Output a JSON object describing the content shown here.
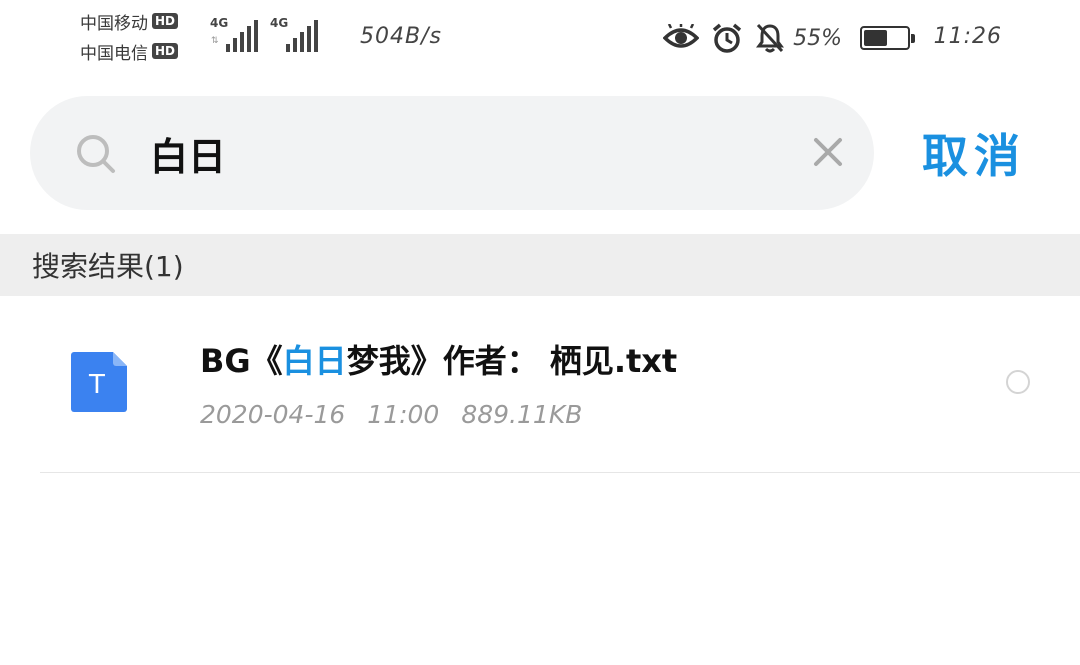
{
  "status_bar": {
    "carriers": [
      {
        "name": "中国移动",
        "badge": "HD",
        "network": "4G"
      },
      {
        "name": "中国电信",
        "badge": "HD",
        "network": "4G"
      }
    ],
    "speed": "504B/s",
    "battery_percent": "55%",
    "battery_level": 0.55,
    "time": "11:26",
    "icons": [
      "eye-comfort-icon",
      "alarm-icon",
      "bell-off-icon",
      "battery-icon"
    ]
  },
  "search": {
    "query": "白日",
    "placeholder": "",
    "cancel_label": "取消"
  },
  "results": {
    "header": "搜索结果(1)",
    "items": [
      {
        "icon": "txt-file-icon",
        "icon_letter": "T",
        "name_prefix": "BG《",
        "name_highlight": "白日",
        "name_suffix": "梦我》作者： 栖见.txt",
        "date": "2020-04-16",
        "time": "11:00",
        "size": "889.11KB"
      }
    ]
  },
  "colors": {
    "accent": "#1a90e0",
    "file_icon": "#3b82f0",
    "search_bg": "#f2f3f4",
    "header_bg": "#eeeeee"
  }
}
